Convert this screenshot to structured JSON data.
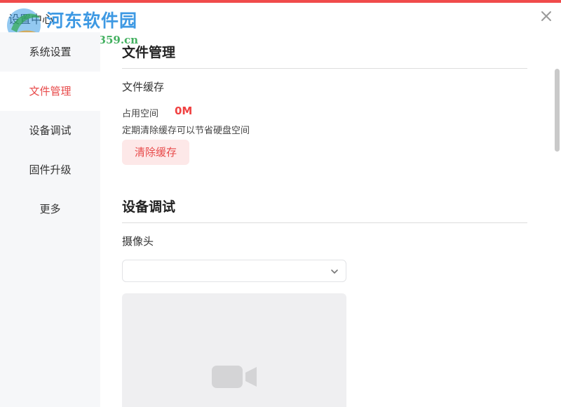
{
  "window": {
    "title": "设置中心",
    "close_icon": "close-icon",
    "accent_color": "#f04b4b"
  },
  "watermark": {
    "text": "河东软件园",
    "url": "www.pc0359.cn"
  },
  "sidebar": {
    "items": [
      {
        "label": "系统设置",
        "active": false
      },
      {
        "label": "文件管理",
        "active": true
      },
      {
        "label": "设备调试",
        "active": false
      },
      {
        "label": "固件升级",
        "active": false
      },
      {
        "label": "更多",
        "active": false
      }
    ],
    "active_color": "#e84a4a"
  },
  "file_management": {
    "title": "文件管理",
    "cache_title": "文件缓存",
    "storage_label": "占用空间",
    "storage_value": "0M",
    "hint": "定期清除缓存可以节省硬盘空间",
    "clear_button": "清除缓存"
  },
  "device_debug": {
    "title": "设备调试",
    "camera_label": "摄像头",
    "camera_select": {
      "value": "",
      "icon": "chevron-down-icon"
    },
    "preview_icon": "video-camera-icon"
  }
}
